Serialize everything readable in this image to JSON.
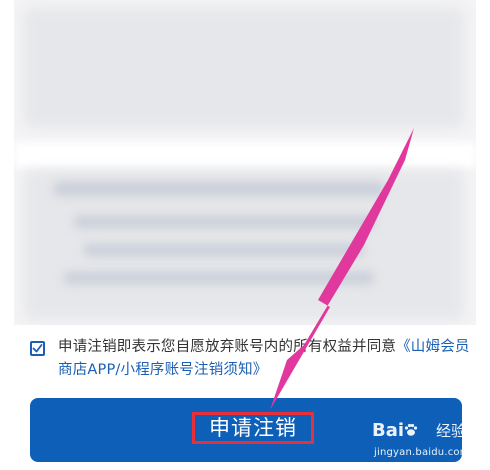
{
  "agreement": {
    "checked": true,
    "text_prefix": "申请注销即表示您自愿放弃账号内的所有权益并同意",
    "link_text": "《山姆会员商店APP/小程序账号注销须知》"
  },
  "primary_action": {
    "label": "申请注销"
  },
  "watermark": {
    "logo_text": "Bai",
    "logo_suffix": "经验",
    "url": "jingyan.baidu.com"
  },
  "colors": {
    "accent": "#0e5fb8",
    "link": "#1a5fb4",
    "highlight_box": "#e8303a",
    "arrow": "#e0389c"
  },
  "icons": {
    "checkbox": "check-icon",
    "watermark": "paw-icon"
  }
}
